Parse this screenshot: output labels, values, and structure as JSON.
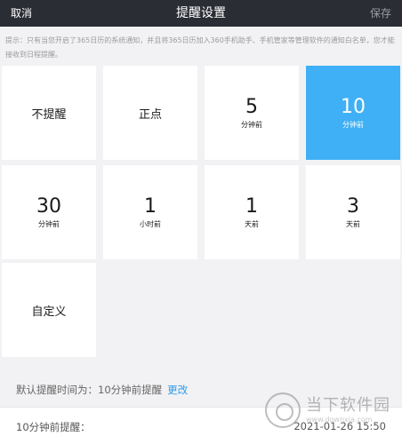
{
  "header": {
    "cancel_label": "取消",
    "title": "提醒设置",
    "save_label": "保存"
  },
  "hint": "提示：只有当您开启了365日历的系统通知，并且将365日历加入360手机助手、手机管家等管理软件的通知白名单，您才能接收到日程提醒。",
  "options": [
    {
      "label": "不提醒",
      "value": "",
      "unit": "",
      "selected": false
    },
    {
      "label": "正点",
      "value": "",
      "unit": "",
      "selected": false
    },
    {
      "label": "",
      "value": "5",
      "unit": "分钟前",
      "selected": false
    },
    {
      "label": "",
      "value": "10",
      "unit": "分钟前",
      "selected": true
    },
    {
      "label": "",
      "value": "30",
      "unit": "分钟前",
      "selected": false
    },
    {
      "label": "",
      "value": "1",
      "unit": "小时前",
      "selected": false
    },
    {
      "label": "",
      "value": "1",
      "unit": "天前",
      "selected": false
    },
    {
      "label": "",
      "value": "3",
      "unit": "天前",
      "selected": false
    },
    {
      "label": "自定义",
      "value": "",
      "unit": "",
      "selected": false
    }
  ],
  "default_row": {
    "text": "默认提醒时间为：10分钟前提醒",
    "change_label": "更改"
  },
  "bottom_row": {
    "left": "10分钟前提醒：",
    "right": "2021-01-26 15:50"
  },
  "colors": {
    "accent": "#3fb0f5",
    "header_bg": "#2b2d35",
    "link": "#2f9ae8"
  },
  "watermark": {
    "text": "当下软件园",
    "url": "www.downxia.com"
  }
}
